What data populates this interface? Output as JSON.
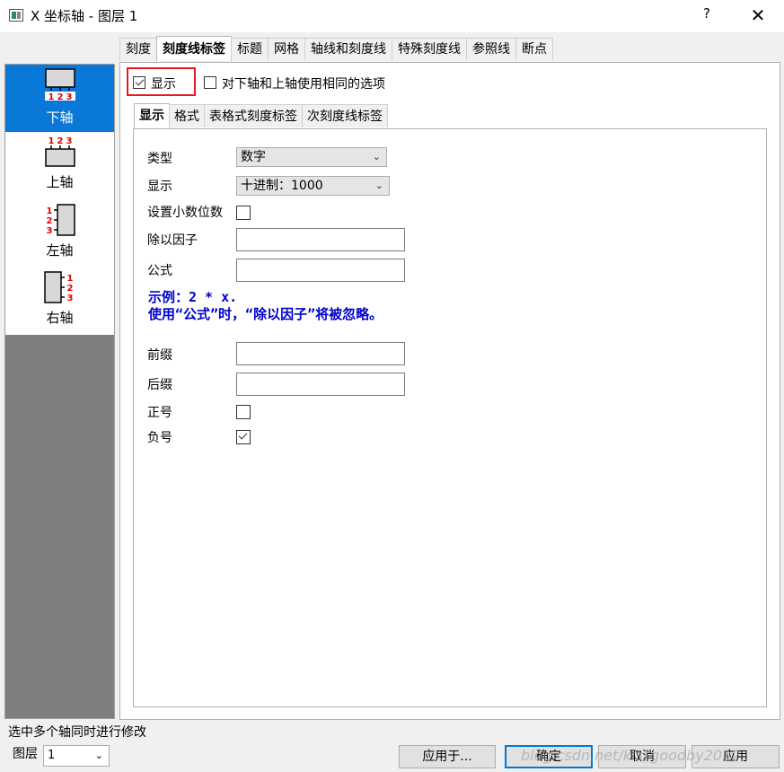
{
  "window": {
    "title": "X 坐标轴 - 图层 1",
    "help_label": "?",
    "close_label": "✕"
  },
  "top_tabs": [
    {
      "label": "刻度",
      "active": false
    },
    {
      "label": "刻度线标签",
      "active": true
    },
    {
      "label": "标题",
      "active": false
    },
    {
      "label": "网格",
      "active": false
    },
    {
      "label": "轴线和刻度线",
      "active": false
    },
    {
      "label": "特殊刻度线",
      "active": false
    },
    {
      "label": "参照线",
      "active": false
    },
    {
      "label": "断点",
      "active": false
    }
  ],
  "axes": [
    {
      "label": "下轴",
      "icon": "bottom-axis-icon",
      "selected": true
    },
    {
      "label": "上轴",
      "icon": "top-axis-icon",
      "selected": false
    },
    {
      "label": "左轴",
      "icon": "left-axis-icon",
      "selected": false
    },
    {
      "label": "右轴",
      "icon": "right-axis-icon",
      "selected": false
    }
  ],
  "axis_icon_digits": [
    "1",
    "2",
    "3"
  ],
  "show": {
    "label": "显示",
    "checked": true
  },
  "same_options": {
    "label": "对下轴和上轴使用相同的选项",
    "checked": false
  },
  "sub_tabs": [
    {
      "label": "显示",
      "active": true
    },
    {
      "label": "格式",
      "active": false
    },
    {
      "label": "表格式刻度标签",
      "active": false
    },
    {
      "label": "次刻度线标签",
      "active": false
    }
  ],
  "form": {
    "type_label": "类型",
    "type_value": "数字",
    "display_label": "显示",
    "display_value": "十进制：1000",
    "decimals_label": "设置小数位数",
    "decimals_checked": false,
    "divide_label": "除以因子",
    "divide_value": "",
    "formula_label": "公式",
    "formula_value": "",
    "example_line1": "示例：2 * x.",
    "example_line2": "使用“公式”时，“除以因子”将被忽略。",
    "prefix_label": "前缀",
    "prefix_value": "",
    "suffix_label": "后缀",
    "suffix_value": "",
    "plus_label": "正号",
    "plus_checked": false,
    "minus_label": "负号",
    "minus_checked": true
  },
  "footer": {
    "status": "选中多个轴同时进行修改",
    "layer_label": "图层",
    "layer_value": "1",
    "apply_to_label": "应用于...",
    "ok_label": "确定",
    "cancel_label": "取消",
    "apply_label": "应用",
    "watermark": "blog.csdn.net/kissgoodby2012"
  },
  "colors": {
    "selection": "#0a78d7",
    "highlight_box": "#e8191c",
    "example_text": "#0000cc",
    "axis_digits": "#e00000"
  }
}
